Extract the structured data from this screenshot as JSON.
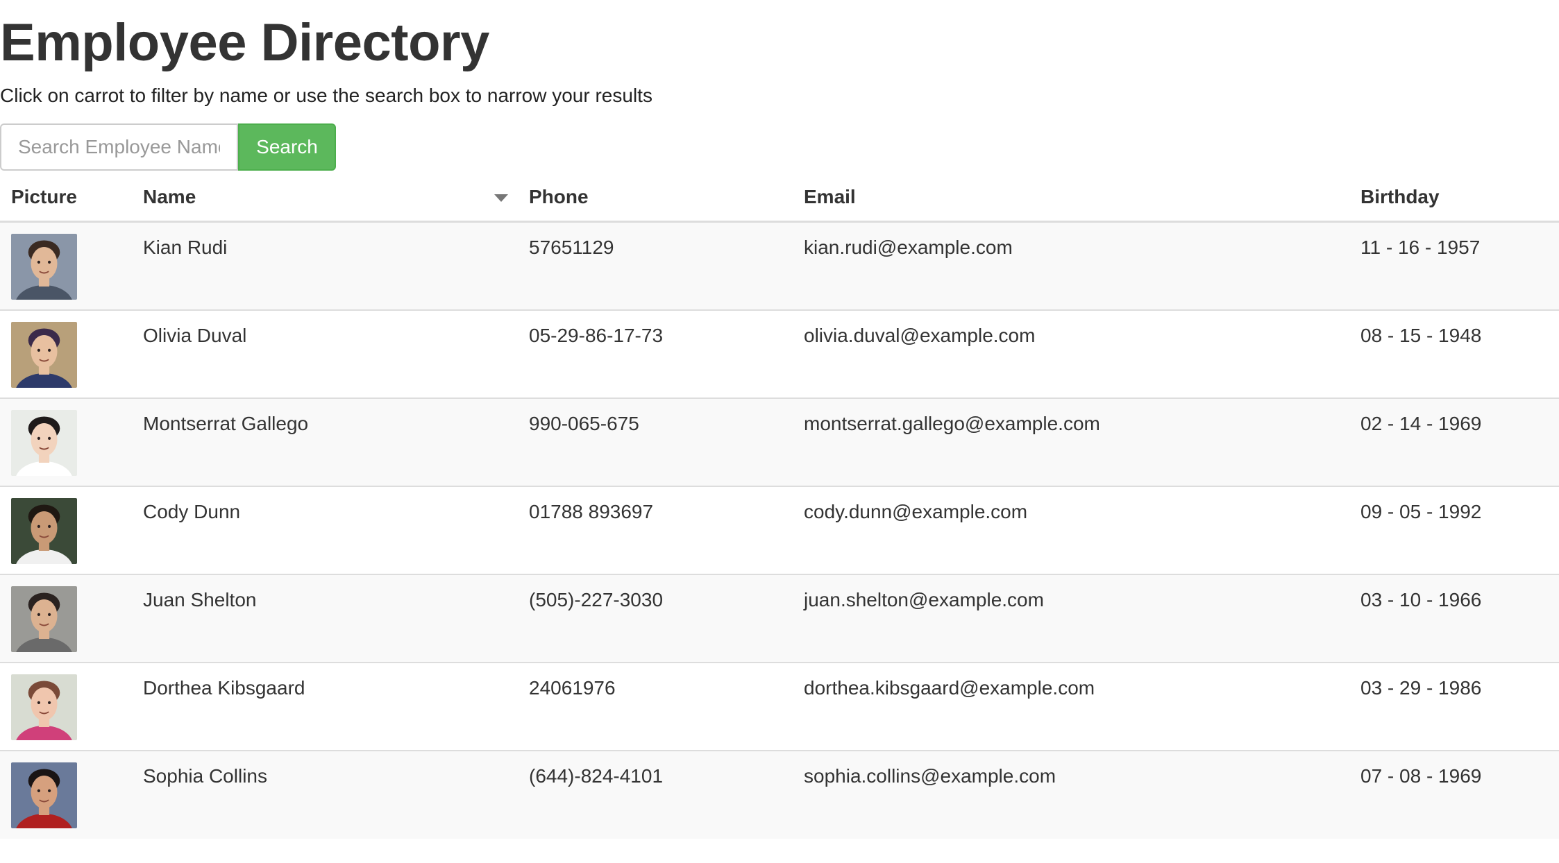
{
  "header": {
    "title": "Employee Directory",
    "subtitle": "Click on carrot to filter by name or use the search box to narrow your results"
  },
  "search": {
    "placeholder": "Search Employee Name",
    "value": "",
    "button_label": "Search"
  },
  "table": {
    "columns": {
      "picture": "Picture",
      "name": "Name",
      "phone": "Phone",
      "email": "Email",
      "birthday": "Birthday"
    },
    "sort_icon": "caret-down-icon",
    "rows": [
      {
        "name": "Kian Rudi",
        "phone": "57651129",
        "email": "kian.rudi@example.com",
        "birthday": "11 - 16 - 1957",
        "avatar": {
          "bg": "#8a96a8",
          "skin": "#e1b898",
          "hair": "#3a2a22",
          "shirt": "#4a5566"
        }
      },
      {
        "name": "Olivia Duval",
        "phone": "05-29-86-17-73",
        "email": "olivia.duval@example.com",
        "birthday": "08 - 15 - 1948",
        "avatar": {
          "bg": "#b8a07a",
          "skin": "#e8c0a0",
          "hair": "#3b2a4a",
          "shirt": "#2d3a6a"
        }
      },
      {
        "name": "Montserrat Gallego",
        "phone": "990-065-675",
        "email": "montserrat.gallego@example.com",
        "birthday": "02 - 14 - 1969",
        "avatar": {
          "bg": "#e9ece8",
          "skin": "#f2d3bd",
          "hair": "#1e1a1a",
          "shirt": "#ffffff"
        }
      },
      {
        "name": "Cody Dunn",
        "phone": "01788 893697",
        "email": "cody.dunn@example.com",
        "birthday": "09 - 05 - 1992",
        "avatar": {
          "bg": "#3b4a38",
          "skin": "#c99a76",
          "hair": "#1f1812",
          "shirt": "#f0f0f0"
        }
      },
      {
        "name": "Juan Shelton",
        "phone": "(505)-227-3030",
        "email": "juan.shelton@example.com",
        "birthday": "03 - 10 - 1966",
        "avatar": {
          "bg": "#9a9a96",
          "skin": "#dcb291",
          "hair": "#2a2220",
          "shirt": "#6a6a6a"
        }
      },
      {
        "name": "Dorthea Kibsgaard",
        "phone": "24061976",
        "email": "dorthea.kibsgaard@example.com",
        "birthday": "03 - 29 - 1986",
        "avatar": {
          "bg": "#d8dcd2",
          "skin": "#f0c6ae",
          "hair": "#7a4a38",
          "shirt": "#d0407a"
        }
      },
      {
        "name": "Sophia Collins",
        "phone": "(644)-824-4101",
        "email": "sophia.collins@example.com",
        "birthday": "07 - 08 - 1969",
        "avatar": {
          "bg": "#6a7a9a",
          "skin": "#d6a07e",
          "hair": "#1a1414",
          "shirt": "#b02020"
        }
      }
    ]
  }
}
